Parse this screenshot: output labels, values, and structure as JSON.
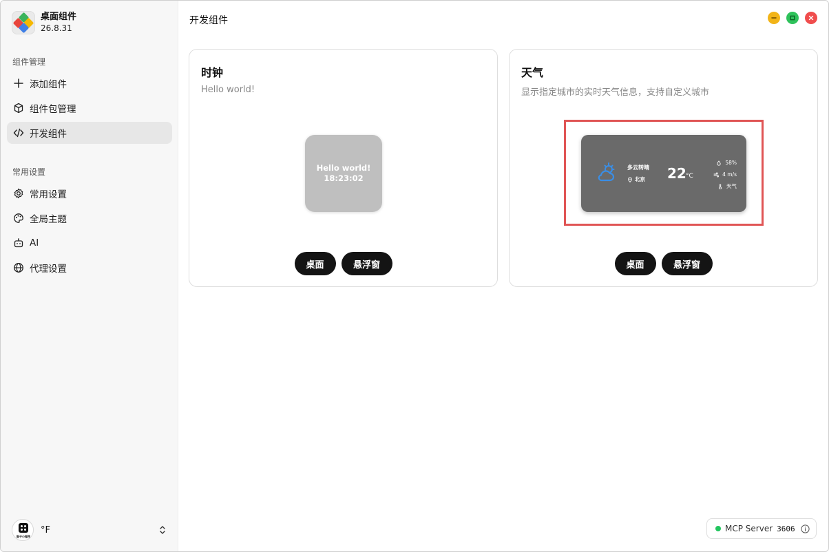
{
  "app": {
    "name": "桌面组件",
    "version": "26.8.31"
  },
  "sidebar": {
    "section1": "组件管理",
    "items1": [
      {
        "label": "添加组件",
        "icon": "plus-icon"
      },
      {
        "label": "组件包管理",
        "icon": "package-icon"
      },
      {
        "label": "开发组件",
        "icon": "code-icon",
        "active": true
      }
    ],
    "section2": "常用设置",
    "items2": [
      {
        "label": "常用设置",
        "icon": "gear-icon"
      },
      {
        "label": "全局主题",
        "icon": "palette-icon"
      },
      {
        "label": "AI",
        "icon": "robot-icon"
      },
      {
        "label": "代理设置",
        "icon": "globe-icon"
      }
    ],
    "user": {
      "name": "°F",
      "avatar_text": "骰子小程序"
    }
  },
  "header": {
    "title": "开发组件"
  },
  "cards": [
    {
      "title": "时钟",
      "description": "Hello world!",
      "preview": {
        "line1": "Hello world!",
        "line2": "18:23:02"
      },
      "buttons": {
        "desktop": "桌面",
        "floating": "悬浮窗"
      }
    },
    {
      "title": "天气",
      "description": "显示指定城市的实时天气信息，支持自定义城市",
      "preview": {
        "condition": "多云转晴",
        "city": "北京",
        "temperature": "22",
        "unit": "°C",
        "humidity": "58%",
        "wind": "4 m/s",
        "label": "天气"
      },
      "buttons": {
        "desktop": "桌面",
        "floating": "悬浮窗"
      }
    }
  ],
  "status": {
    "mcp_label": "MCP Server",
    "mcp_port": "3606",
    "mcp_status_color": "#22c55e"
  },
  "colors": {
    "highlight": "#e05555",
    "window_min": "#f2b418",
    "window_max": "#2fc25b",
    "window_close": "#f04d4d"
  }
}
